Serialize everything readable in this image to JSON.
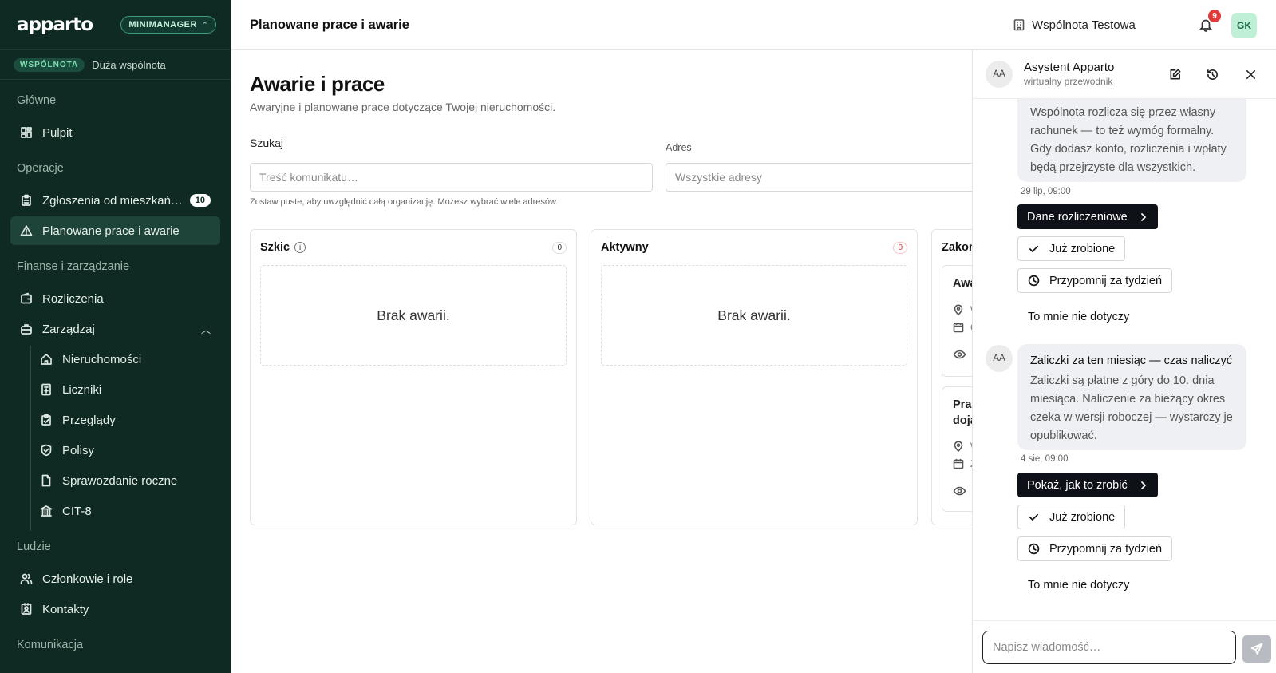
{
  "brand": {
    "logo": "apparto",
    "plan": "MINIMANAGER"
  },
  "org": {
    "badge": "WSPÓLNOTA",
    "name": "Duża wspólnota"
  },
  "sidebar": {
    "sections": {
      "main": "Główne",
      "ops": "Operacje",
      "finance": "Finanse i zarządzanie",
      "people": "Ludzie",
      "comms": "Komunikacja"
    },
    "items": {
      "dashboard": "Pulpit",
      "requests": "Zgłoszenia od mieszkań…",
      "requests_count": "10",
      "works": "Planowane prace i awarie",
      "billing": "Rozliczenia",
      "manage": "Zarządzaj",
      "properties": "Nieruchomości",
      "meters": "Liczniki",
      "inspections": "Przeglądy",
      "policies": "Polisy",
      "annual_report": "Sprawozdanie roczne",
      "cit8": "CIT-8",
      "members": "Członkowie i role",
      "contacts": "Kontakty"
    }
  },
  "topbar": {
    "title": "Planowane prace i awarie",
    "community": "Wspólnota Testowa",
    "notifications": "9",
    "user_initials": "GK"
  },
  "main": {
    "heading": "Awarie i prace",
    "subtitle": "Awaryjne i planowane prace dotyczące Twojej nieruchomości.",
    "search_label": "Szukaj",
    "search_placeholder": "Treść komunikatu…",
    "address_label": "Adres",
    "address_placeholder": "Wszystkie adresy",
    "hint": "Zostaw puste, aby uwzględnić całą organizację. Możesz wybrać wiele adresów.",
    "columns": [
      {
        "title": "Szkic",
        "count": "0",
        "empty": "Brak awarii."
      },
      {
        "title": "Aktywny",
        "count": "0",
        "empty": "Brak awarii."
      },
      {
        "title": "Zakon"
      }
    ],
    "cards": [
      {
        "title": "Awa",
        "meta1": "W",
        "meta2": "C"
      },
      {
        "title_line1": "Prac",
        "title_line2": "doja",
        "meta1": "W",
        "meta2": "Z"
      }
    ]
  },
  "assistant": {
    "initials": "AA",
    "name": "Asystent Apparto",
    "role": "wirtualny przewodnik",
    "messages": [
      {
        "text": "Wspólnota rozlicza się przez własny rachunek — to też wymóg formalny. Gdy dodasz konto, rozliczenia i wpłaty będą przejrzyste dla wszystkich.",
        "time": "29 lip, 09:00",
        "primary": "Dane rozliczeniowe",
        "done": "Już zrobione",
        "remind": "Przypomnij za tydzień",
        "dismiss": "To mnie nie dotyczy"
      },
      {
        "title": "Zaliczki za ten miesiąc — czas naliczyć",
        "text": "Zaliczki są płatne z góry do 10. dnia miesiąca. Naliczenie za bieżący okres czeka w wersji roboczej — wystarczy je opublikować.",
        "time": "4 sie, 09:00",
        "primary": "Pokaż, jak to zrobić",
        "done": "Już zrobione",
        "remind": "Przypomnij za tydzień",
        "dismiss": "To mnie nie dotyczy"
      }
    ],
    "compose_placeholder": "Napisz wiadomość…"
  }
}
